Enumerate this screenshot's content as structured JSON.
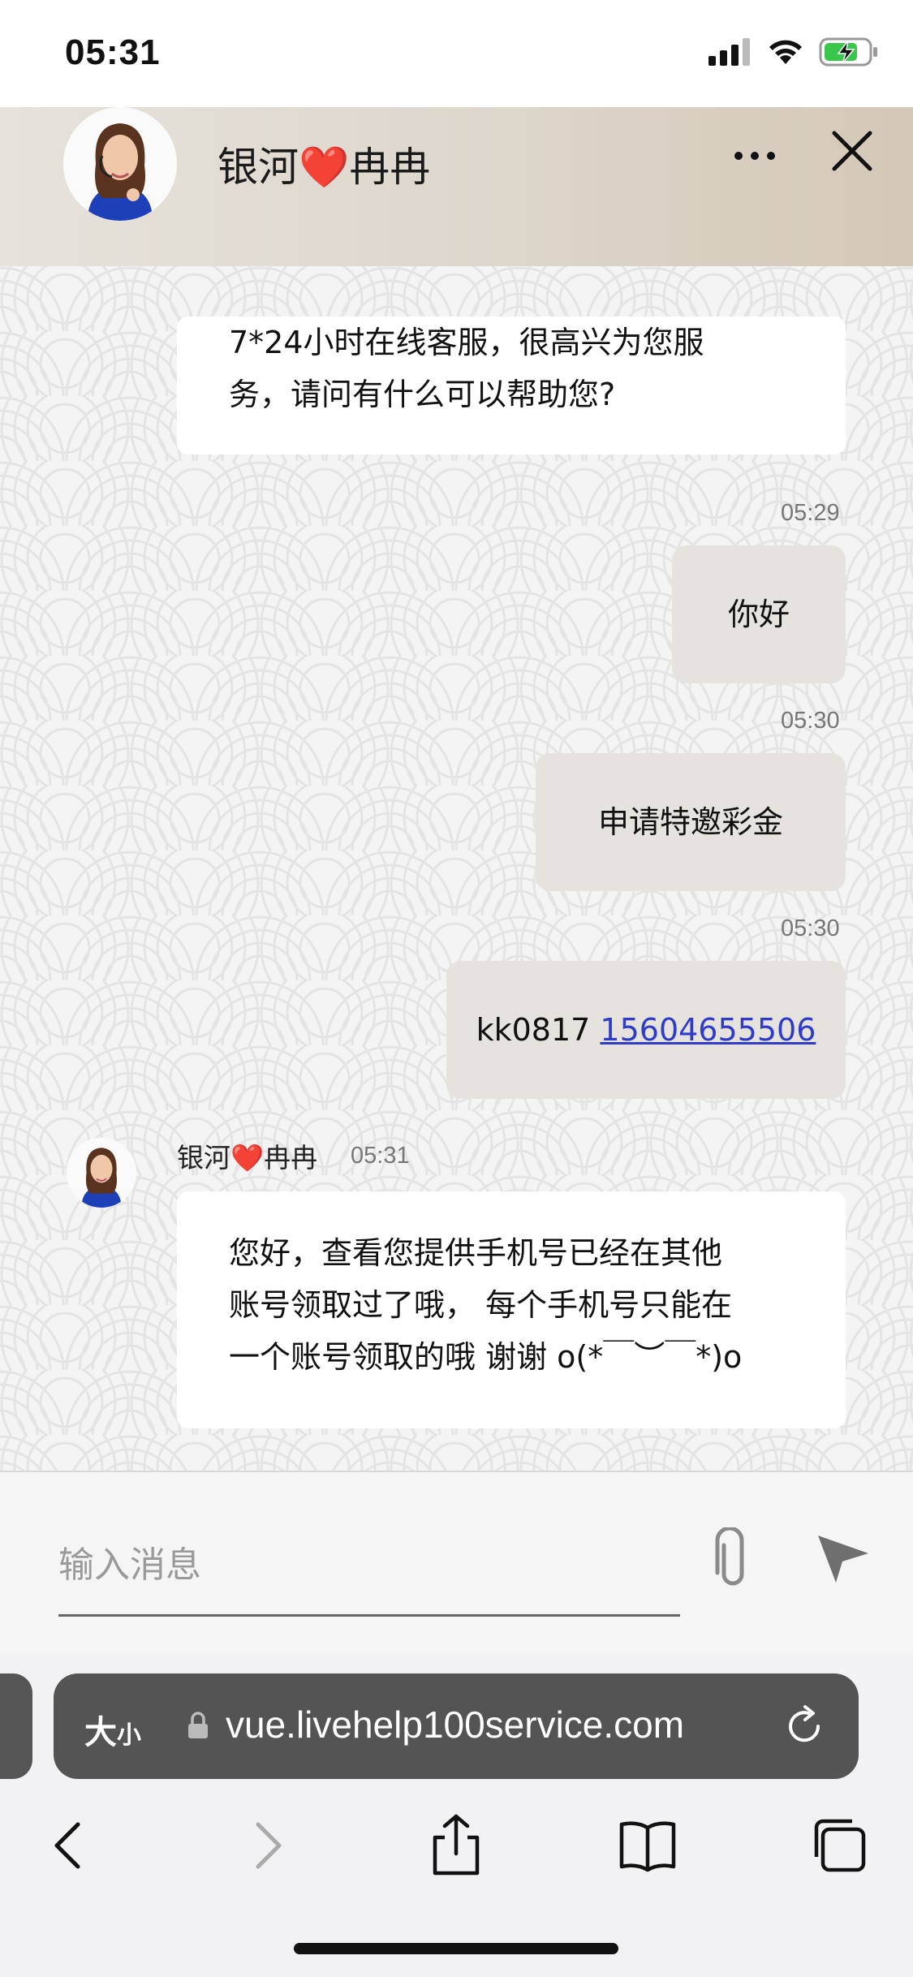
{
  "status_bar": {
    "time": "05:31"
  },
  "header": {
    "name_prefix": "银河",
    "name_heart": "❤️",
    "name_suffix": "冉冉"
  },
  "messages": [
    {
      "from": "agent",
      "lines": [
        "7*24小时在线客服，很高兴为您服",
        "务，请问有什么可以帮助您?"
      ]
    },
    {
      "from": "user",
      "time": "05:29",
      "text": "你好"
    },
    {
      "from": "user",
      "time": "05:30",
      "text": "申请特邀彩金"
    },
    {
      "from": "user",
      "time": "05:30",
      "text_prefix": "kk0817 ",
      "link": "15604655506"
    },
    {
      "from": "agent",
      "sender": "银河❤️冉冉",
      "time": "05:31",
      "lines": [
        "您好，查看您提供手机号已经在其他",
        "账号领取过了哦， 每个手机号只能在",
        "一个账号领取的哦 谢谢 o(*￣︶￣*)o"
      ]
    }
  ],
  "composer": {
    "placeholder": "输入消息"
  },
  "browser": {
    "size_label": "大",
    "size_small": "小",
    "url": "vue.livehelp100service.com"
  }
}
